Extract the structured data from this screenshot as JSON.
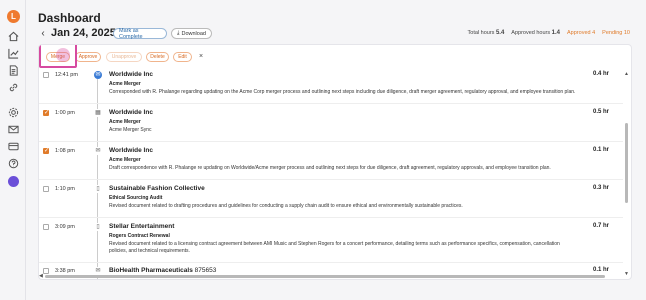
{
  "page": {
    "title": "Dashboard"
  },
  "date_nav": {
    "prev_icon": "chevron-left-icon",
    "date": "Jan 24, 2025",
    "next_icon": "chevron-right-icon"
  },
  "actions": {
    "mark_complete": "Mark as Complete",
    "download": "Download"
  },
  "summary": {
    "total_label": "Total hours",
    "total_value": "5.4",
    "approved_label": "Approved hours",
    "approved_value": "1.4",
    "approved_count": "Approved 4",
    "pending_count": "Pending 10"
  },
  "toolbar": {
    "merge": "Merge",
    "approve": "Approve",
    "unapprove": "Unapprove",
    "delete": "Delete",
    "edit": "Edit",
    "close": "×"
  },
  "colors": {
    "accent": "#e07b2a",
    "highlight": "#d64aa0",
    "link": "#2c6ba8"
  },
  "entries": [
    {
      "time": "12:41 pm",
      "checked": false,
      "icon": "chat-icon",
      "client": "Worldwide Inc",
      "matter": "Acme Merger",
      "description": "Corresponded with R. Phalange regarding updating on the Acme Corp merger process and outlining next steps including due diligence, draft merger agreement, regulatory approval, and employee transition plan.",
      "hours": "0.4 hr"
    },
    {
      "time": "1:00 pm",
      "checked": true,
      "icon": "calendar-icon",
      "client": "Worldwide Inc",
      "matter": "Acme Merger",
      "description": "Acme Merger Sync",
      "hours": "0.5 hr"
    },
    {
      "time": "1:08 pm",
      "checked": true,
      "icon": "mail-icon",
      "client": "Worldwide Inc",
      "matter": "Acme Merger",
      "description": "Draft correspondence with R. Phalange re updating on Worldwide/Acme merger process and outlining next steps for due diligence, draft agreement, regulatory approvals, and employee transition plan.",
      "hours": "0.1 hr"
    },
    {
      "time": "1:10 pm",
      "checked": false,
      "icon": "document-icon",
      "client": "Sustainable Fashion Collective",
      "matter": "Ethical Sourcing Audit",
      "description": "Revised document related to drafting procedures and guidelines for conducting a supply chain audit to ensure ethical and environmentally sustainable practices.",
      "hours": "0.3 hr"
    },
    {
      "time": "3:09 pm",
      "checked": false,
      "icon": "document-icon",
      "client": "Stellar Entertainment",
      "matter": "Rogers Contract Renewal",
      "description": "Revised document related to a licensing contract agreement between AMI Music and Stephen Rogers for a concert performance, detailing terms such as performance specifics, compensation, cancellation policies, and technical requirements.",
      "hours": "0.7 hr"
    },
    {
      "time": "3:38 pm",
      "checked": false,
      "icon": "mail-icon",
      "client": "BioHealth Pharmaceuticals",
      "client_suffix": "875653",
      "matter": "",
      "description": "",
      "hours": "0.1 hr"
    }
  ]
}
